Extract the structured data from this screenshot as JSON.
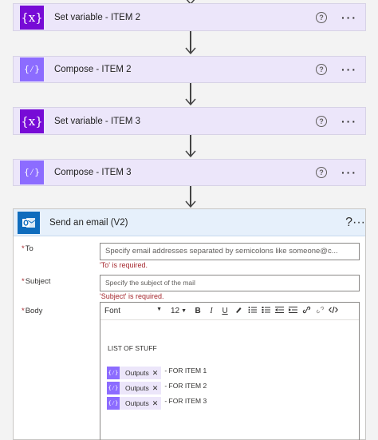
{
  "steps": [
    {
      "title": "Set variable - ITEM 2",
      "icon": "variable-icon"
    },
    {
      "title": "Compose - ITEM 2",
      "icon": "compose-icon"
    },
    {
      "title": "Set variable - ITEM 3",
      "icon": "variable-icon"
    },
    {
      "title": "Compose - ITEM 3",
      "icon": "compose-icon"
    }
  ],
  "icons": {
    "variable": "{x}",
    "compose": "{⁄}",
    "help": "?",
    "more": "···"
  },
  "email": {
    "title": "Send an email (V2)",
    "to_label": "To",
    "to_placeholder": "Specify email addresses separated by semicolons like someone@c...",
    "to_error": "'To' is required.",
    "subject_label": "Subject",
    "subject_placeholder": "Specify the subject of the mail",
    "subject_error": "'Subject' is required.",
    "body_label": "Body",
    "required_mark": "*",
    "toolbar": {
      "font": "Font",
      "size": "12",
      "bold": "B",
      "italic": "I",
      "underline": "U"
    },
    "body_text": "LIST OF STUFF",
    "tokens": [
      {
        "label": "Outputs",
        "suffix": "- FOR ITEM 1"
      },
      {
        "label": "Outputs",
        "suffix": "- FOR ITEM 2"
      },
      {
        "label": "Outputs",
        "suffix": "- FOR ITEM 3"
      }
    ]
  },
  "colors": {
    "variable": "#770bd6",
    "compose": "#8c6cff",
    "outlook": "#0f6cbd",
    "error": "#a4262c"
  }
}
